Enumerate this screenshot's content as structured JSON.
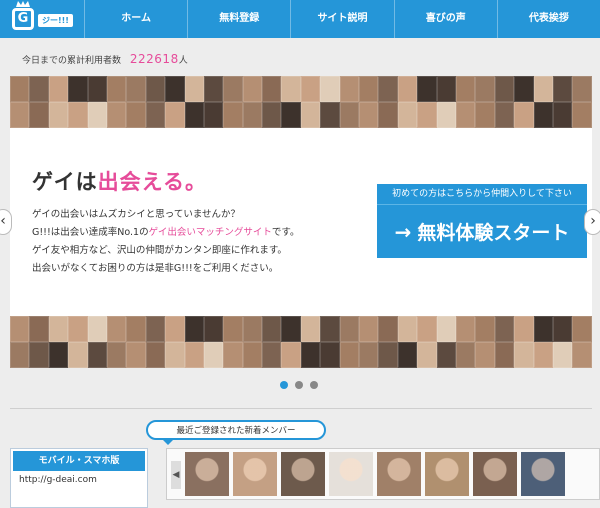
{
  "header": {
    "logo_text": "G",
    "logo_tag": "ジー!!!",
    "nav": [
      {
        "label": "ホーム"
      },
      {
        "label": "無料登録"
      },
      {
        "label": "サイト説明"
      },
      {
        "label": "喜びの声"
      },
      {
        "label": "代表挨拶"
      }
    ],
    "bg_color": "#2596d8"
  },
  "stats": {
    "label": "今日までの累計利用者数",
    "count": "222618",
    "unit": "人"
  },
  "hero": {
    "headline_pre": "ゲイは",
    "headline_hl": "出会える。",
    "desc": {
      "line1": "ゲイの出会いはムズカシイと思っていませんか？",
      "line2_pre": "G!!!は出会い達成率No.1の",
      "line2_hl": "ゲイ出会いマッチングサイト",
      "line2_post": "です。",
      "line3": "ゲイ友や相方など、沢山の仲間がカンタン即座に作れます。",
      "line4": "出会いがなくてお困りの方は是非G!!!をご利用ください。"
    },
    "cta_note": "初めての方はこちらから仲間入りして下さい",
    "cta_arrow": "→",
    "cta_label": "無料体験スタート",
    "accent_color": "#e64c9a"
  },
  "slider": {
    "prev": "‹",
    "next": "›",
    "dots": 3,
    "active": 0
  },
  "recent": {
    "label": "最近ご登録された新着メンバー",
    "prev": "◀"
  },
  "mobile": {
    "title": "モバイル・スマホ版",
    "url": "http://g-deai.com"
  }
}
